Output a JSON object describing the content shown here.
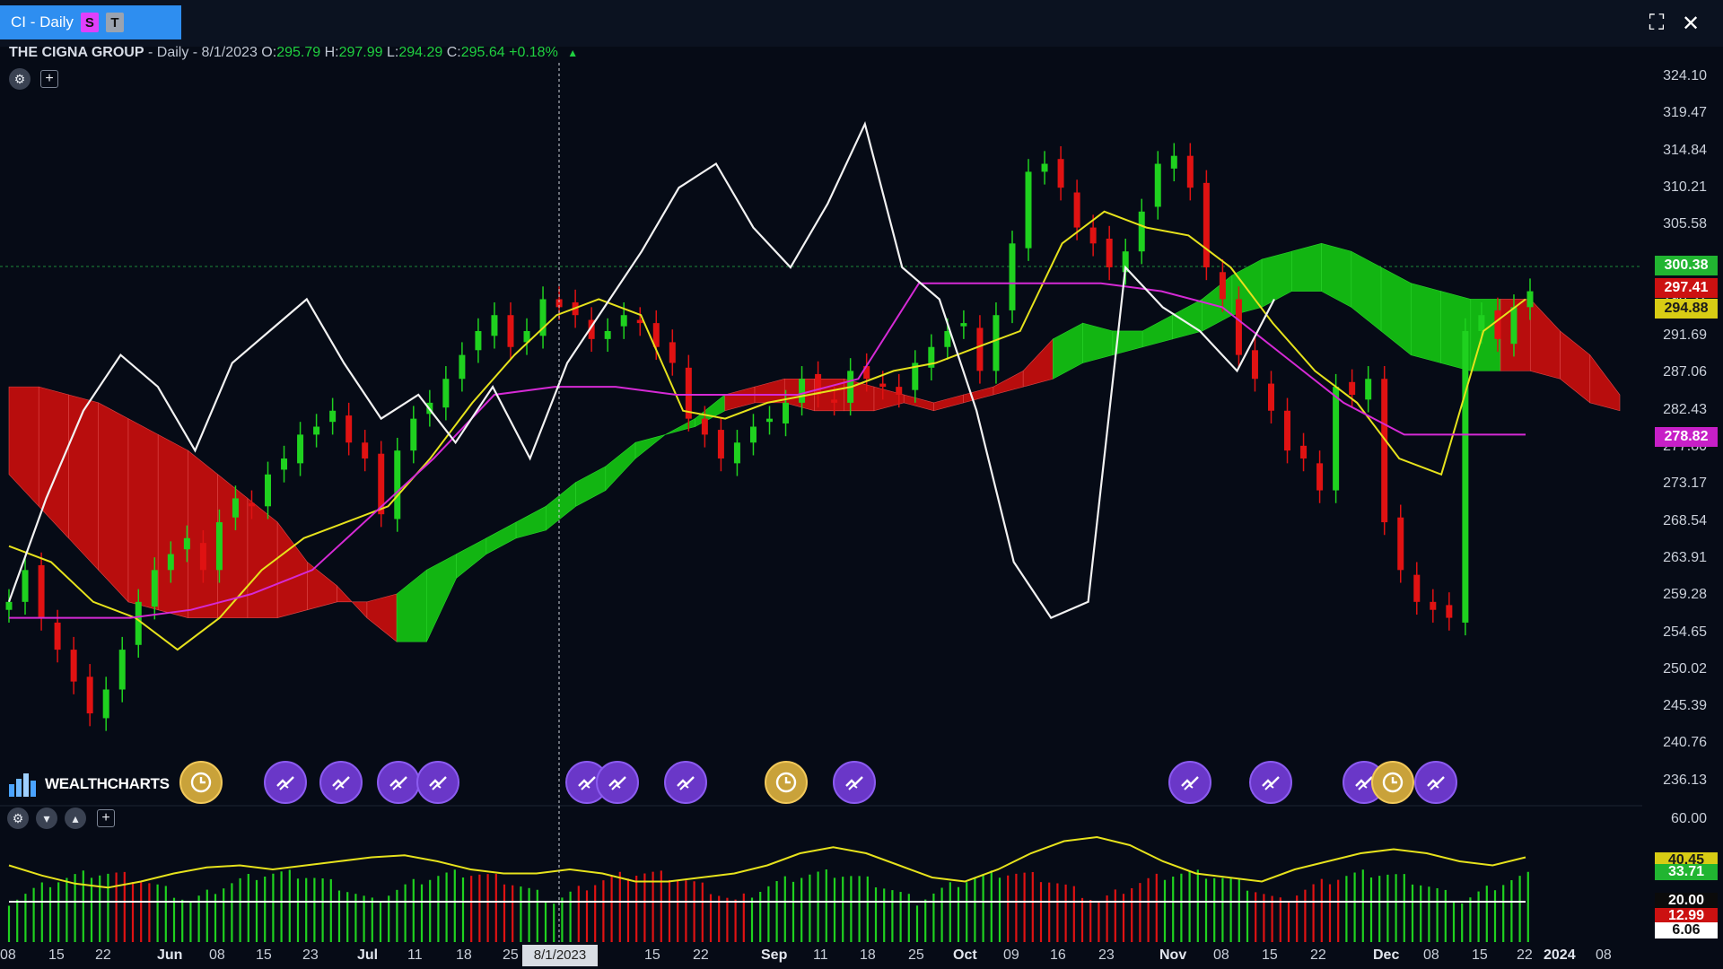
{
  "window": {
    "tab_title": "CI - Daily",
    "badge_s": "S",
    "badge_t": "T",
    "fullscreen_icon": "⛶",
    "close_icon": "✕"
  },
  "info": {
    "symbol": "THE CIGNA GROUP",
    "interval": "- Daily",
    "date": "- 8/1/2023",
    "open_label": "O:",
    "open": "295.79",
    "high_label": "H:",
    "high": "297.99",
    "low_label": "L:",
    "low": "294.29",
    "close_label": "C:",
    "close": "295.64",
    "change": "+0.18%",
    "change_arrow": "▲"
  },
  "price_axis": [
    "324.10",
    "319.47",
    "314.84",
    "310.21",
    "305.58",
    "300.95",
    "296.32",
    "291.69",
    "287.06",
    "282.43",
    "277.80",
    "273.17",
    "268.54",
    "263.91",
    "259.28",
    "254.65",
    "250.02",
    "245.39",
    "240.76",
    "236.13"
  ],
  "price_tags": [
    {
      "text": "300.38",
      "bg": "#21b531",
      "fg": "#ffffff"
    },
    {
      "text": "297.41",
      "bg": "#cc1111",
      "fg": "#ffffff"
    },
    {
      "text": "294.88",
      "bg": "#d8cc14",
      "fg": "#1a1a1a"
    },
    {
      "text": "278.82",
      "bg": "#c71fc7",
      "fg": "#ffffff"
    }
  ],
  "osc_axis": [
    "60.00",
    "20.00",
    "6.06"
  ],
  "osc_tags": [
    {
      "text": "40.45",
      "bg": "#d8cc14",
      "fg": "#1a1a1a"
    },
    {
      "text": "33.71",
      "bg": "#21b531",
      "fg": "#ffffff"
    },
    {
      "text": "20.00",
      "bg": "#0b0b0b",
      "fg": "#ffffff"
    },
    {
      "text": "12.99",
      "bg": "#cc1111",
      "fg": "#ffffff"
    },
    {
      "text": "6.06",
      "bg": "#ffffff",
      "fg": "#111111"
    }
  ],
  "date_axis": [
    {
      "text": "08",
      "bold": false
    },
    {
      "text": "15",
      "bold": false
    },
    {
      "text": "22",
      "bold": false
    },
    {
      "text": "Jun",
      "bold": true
    },
    {
      "text": "08",
      "bold": false
    },
    {
      "text": "15",
      "bold": false
    },
    {
      "text": "23",
      "bold": false
    },
    {
      "text": "Jul",
      "bold": true
    },
    {
      "text": "11",
      "bold": false
    },
    {
      "text": "18",
      "bold": false
    },
    {
      "text": "25",
      "bold": false
    },
    {
      "text": "08",
      "bold": false
    },
    {
      "text": "15",
      "bold": false
    },
    {
      "text": "22",
      "bold": false
    },
    {
      "text": "Sep",
      "bold": true
    },
    {
      "text": "11",
      "bold": false
    },
    {
      "text": "18",
      "bold": false
    },
    {
      "text": "25",
      "bold": false
    },
    {
      "text": "Oct",
      "bold": true
    },
    {
      "text": "09",
      "bold": false
    },
    {
      "text": "16",
      "bold": false
    },
    {
      "text": "23",
      "bold": false
    },
    {
      "text": "Nov",
      "bold": true
    },
    {
      "text": "08",
      "bold": false
    },
    {
      "text": "15",
      "bold": false
    },
    {
      "text": "22",
      "bold": false
    },
    {
      "text": "Dec",
      "bold": true
    },
    {
      "text": "08",
      "bold": false
    },
    {
      "text": "15",
      "bold": false
    },
    {
      "text": "22",
      "bold": false
    },
    {
      "text": "2024",
      "bold": true
    },
    {
      "text": "08",
      "bold": false
    }
  ],
  "cursor_date": "8/1/2023",
  "logo_text": "WEALTHCHARTS",
  "events": [
    {
      "type": "earnings"
    },
    {
      "type": "dividend"
    },
    {
      "type": "dividend"
    },
    {
      "type": "dividend"
    },
    {
      "type": "dividend"
    },
    {
      "type": "dividend"
    },
    {
      "type": "dividend"
    },
    {
      "type": "dividend"
    },
    {
      "type": "earnings"
    },
    {
      "type": "dividend"
    },
    {
      "type": "dividend"
    },
    {
      "type": "dividend"
    },
    {
      "type": "dividend"
    },
    {
      "type": "earnings"
    },
    {
      "type": "dividend"
    }
  ],
  "colors": {
    "background": "#060b16",
    "up_candle": "#1fd11f",
    "down_candle": "#e01212",
    "cloud_bull": "#12b512",
    "cloud_bear": "#b80d0d",
    "tenkan": "#e6e21c",
    "kijun": "#d52ad5",
    "chikou": "#f2f2f2",
    "osc_signal": "#e6e21c"
  },
  "chart_data": {
    "type": "line",
    "title": "THE CIGNA GROUP - Daily",
    "ylim": [
      236.13,
      324.1
    ],
    "close": [
      258,
      262,
      256,
      252,
      248,
      244,
      247,
      252,
      258,
      262,
      264,
      266,
      262,
      268,
      271,
      270,
      274,
      276,
      279,
      280,
      282,
      278,
      276,
      269,
      277,
      281,
      283,
      286,
      289,
      292,
      294,
      290,
      292,
      296,
      295,
      294,
      291,
      292,
      294,
      293,
      290,
      288,
      281,
      279,
      276,
      278,
      280,
      281,
      283,
      286,
      284,
      283,
      287,
      286,
      285,
      284,
      288,
      290,
      292,
      293,
      287,
      294,
      303,
      312,
      313,
      310,
      305,
      303,
      300,
      302,
      307,
      313,
      314,
      310,
      300,
      296,
      289,
      286,
      282,
      277,
      276,
      272,
      285,
      284,
      286,
      268,
      262,
      258,
      257,
      256,
      292,
      294,
      291,
      295,
      297
    ],
    "cloud_top": [
      285,
      285,
      284,
      283,
      281,
      279,
      277,
      274,
      271,
      268,
      263,
      260,
      256,
      253,
      253,
      261,
      264,
      266,
      267,
      270,
      272,
      276,
      279,
      281,
      284,
      285,
      286,
      286,
      286,
      285,
      284,
      283,
      284,
      285,
      287,
      291,
      293,
      292,
      292,
      294,
      296,
      299,
      301,
      302,
      303,
      302,
      300,
      298,
      297,
      296,
      296,
      296,
      292,
      289,
      284
    ],
    "cloud_bottom": [
      274,
      270,
      266,
      262,
      258,
      257,
      256,
      256,
      256,
      256,
      257,
      258,
      258,
      259,
      262,
      264,
      266,
      268,
      270,
      273,
      275,
      278,
      279,
      280,
      282,
      283,
      283,
      282,
      282,
      282,
      283,
      282,
      283,
      284,
      285,
      286,
      288,
      289,
      290,
      291,
      292,
      294,
      295,
      297,
      297,
      295,
      292,
      289,
      288,
      287,
      287,
      287,
      286,
      283,
      282
    ],
    "tenkan_sen": [
      265,
      263,
      258,
      256,
      252,
      256,
      262,
      266,
      268,
      270,
      276,
      283,
      289,
      294,
      296,
      294,
      282,
      281,
      283,
      284,
      285,
      287,
      288,
      290,
      292,
      303,
      307,
      305,
      304,
      300,
      293,
      287,
      283,
      276,
      274,
      292,
      296
    ],
    "kijun_sen": [
      256,
      256,
      256,
      257,
      259,
      262,
      269,
      276,
      284,
      285,
      285,
      284,
      284,
      284,
      286,
      298,
      298,
      298,
      298,
      297,
      295,
      289,
      283,
      279,
      279,
      279
    ],
    "oscillator": [
      38,
      33,
      29,
      27,
      30,
      34,
      37,
      38,
      36,
      38,
      40,
      42,
      43,
      40,
      36,
      34,
      34,
      36,
      34,
      30,
      30,
      32,
      34,
      38,
      44,
      47,
      44,
      38,
      32,
      30,
      36,
      44,
      50,
      52,
      48,
      40,
      34,
      32,
      30,
      36,
      40,
      44,
      46,
      44,
      40,
      38,
      42
    ]
  }
}
